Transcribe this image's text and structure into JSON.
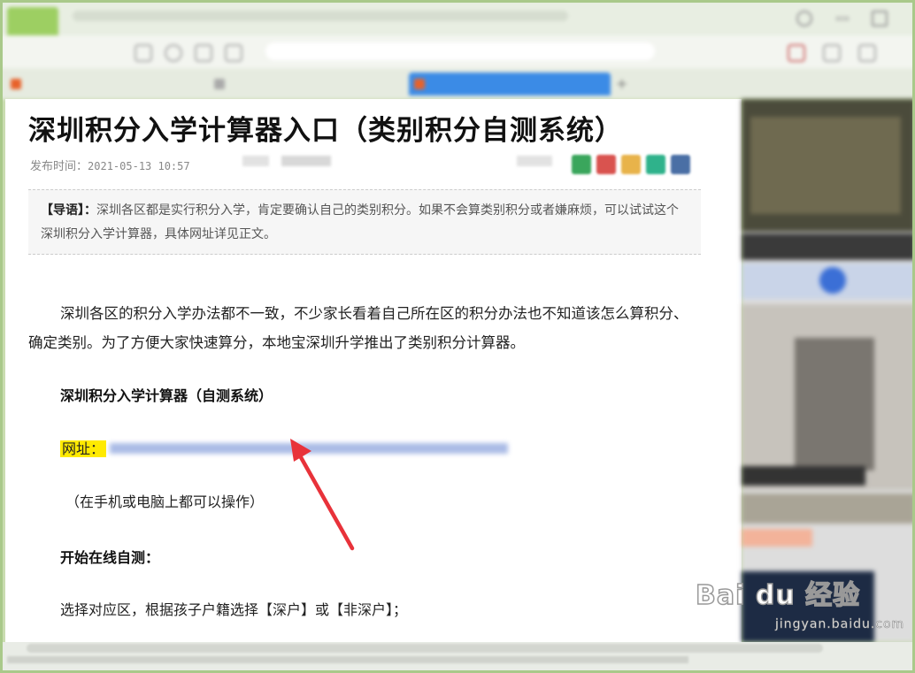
{
  "article": {
    "title": "深圳积分入学计算器入口（类别积分自测系统）",
    "meta_label": "发布时间：",
    "date": "2021-05-13 10:57",
    "intro_label": "【导语】：",
    "intro_text": "深圳各区都是实行积分入学，肯定要确认自己的类别积分。如果不会算类别积分或者嫌麻烦，可以试试这个深圳积分入学计算器，具体网址详见正文。",
    "paragraph": "深圳各区的积分入学办法都不一致，不少家长看着自己所在区的积分办法也不知道该怎么算积分、确定类别。为了方便大家快速算分，本地宝深圳升学推出了类别积分计算器。",
    "heading": "深圳积分入学计算器（自测系统）",
    "url_label": "网址：",
    "note": "（在手机或电脑上都可以操作）",
    "heading2": "开始在线自测：",
    "step": "选择对应区，根据孩子户籍选择【深户】或【非深户】；"
  },
  "share_colors": [
    "#3aa65c",
    "#d9534f",
    "#e8b34a",
    "#2fb28b",
    "#4a6fa5"
  ],
  "accent": "#3b8be6",
  "highlight": "#ffea00",
  "arrow_color": "#e8323a",
  "watermark": {
    "logo": "Bai du 经验",
    "sub": "jingyan.baidu.com"
  },
  "icons": [
    "back-icon",
    "refresh-icon",
    "home-icon",
    "close-icon",
    "tab-favicon-icon",
    "arrow-annotation-icon"
  ]
}
